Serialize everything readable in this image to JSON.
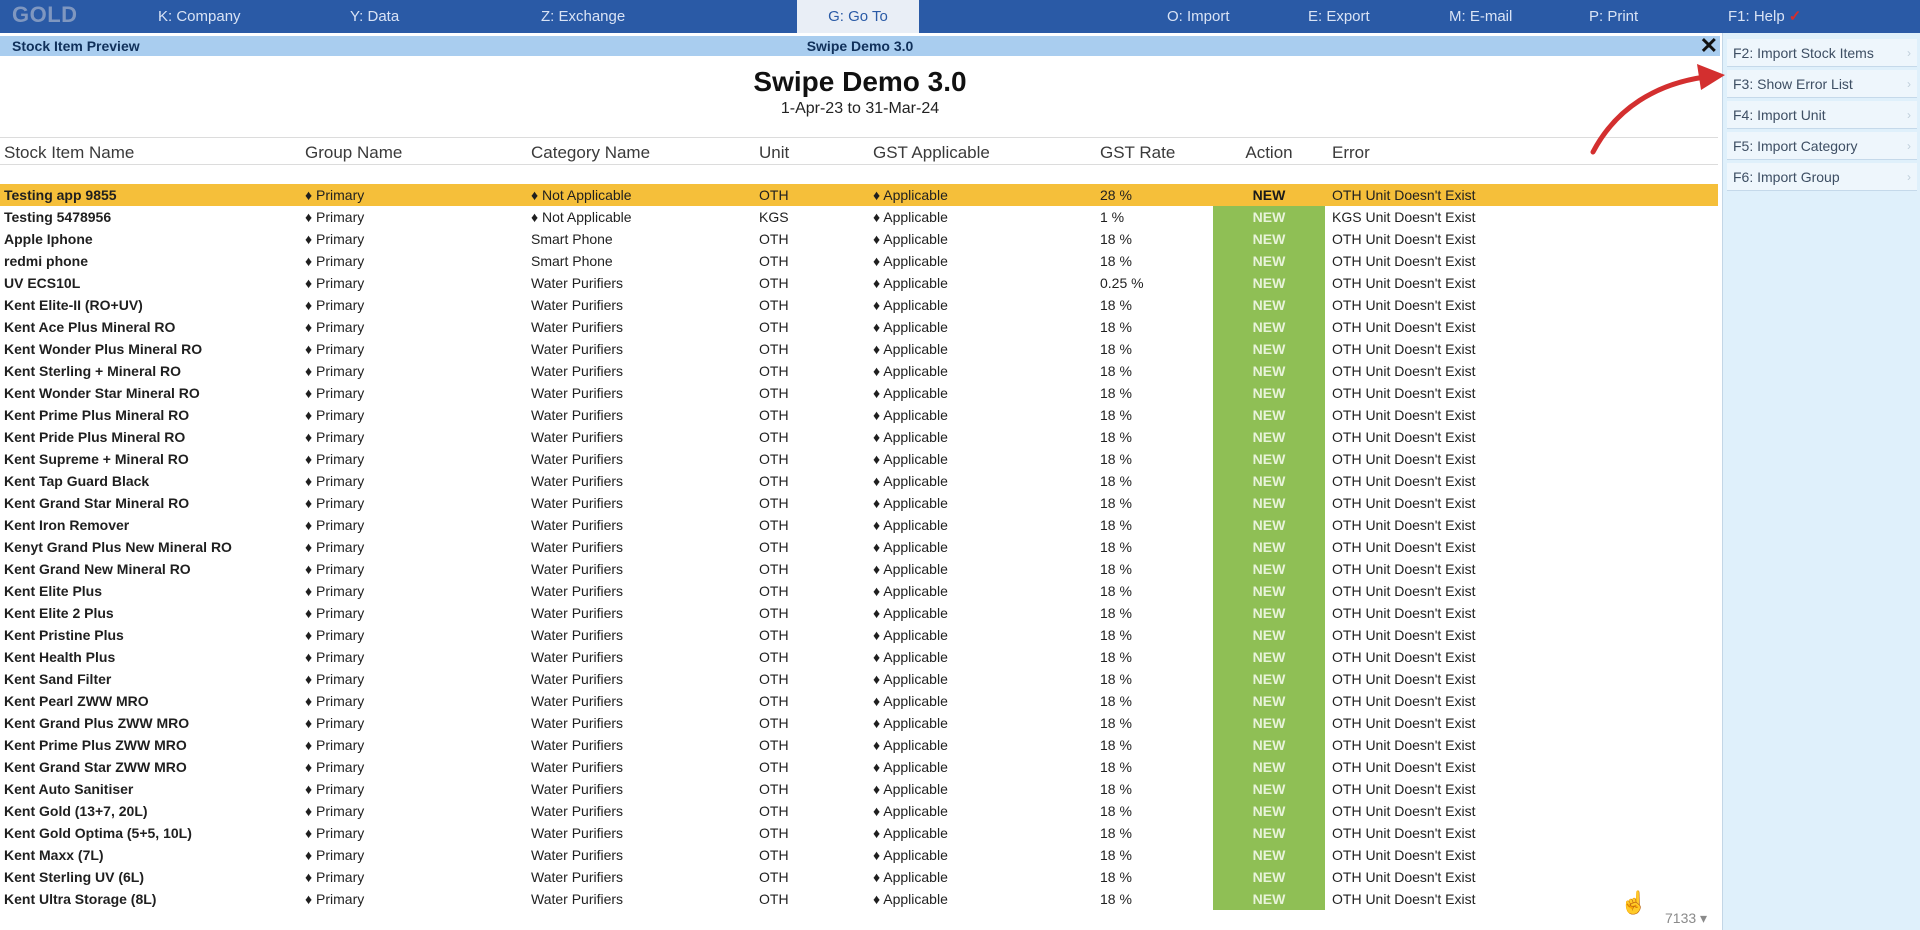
{
  "topbar": {
    "logo": "GOLD",
    "menu": [
      {
        "label": "K: Company"
      },
      {
        "label": "Y: Data"
      },
      {
        "label": "Z: Exchange"
      },
      {
        "label": "G: Go To"
      },
      {
        "label": "O: Import"
      },
      {
        "label": "E: Export"
      },
      {
        "label": "M: E-mail"
      },
      {
        "label": "P: Print"
      },
      {
        "label": "F1: Help"
      }
    ]
  },
  "titlebar": {
    "left": "Stock Item Preview",
    "center": "Swipe Demo 3.0",
    "close": "✕"
  },
  "report": {
    "title": "Swipe Demo 3.0",
    "period": "1-Apr-23 to 31-Mar-24"
  },
  "columns": {
    "name": "Stock Item Name",
    "group": "Group Name",
    "category": "Category Name",
    "unit": "Unit",
    "gst": "GST Applicable",
    "rate": "GST Rate",
    "action": "Action",
    "error": "Error"
  },
  "rows": [
    {
      "name": "Testing app 9855",
      "group": "♦ Primary",
      "category": "♦ Not Applicable",
      "unit": "OTH",
      "gst": "♦ Applicable",
      "rate": "28 %",
      "action": "NEW",
      "error": "OTH Unit Doesn't Exist"
    },
    {
      "name": "Testing 5478956",
      "group": "♦ Primary",
      "category": "♦ Not Applicable",
      "unit": "KGS",
      "gst": "♦ Applicable",
      "rate": "1 %",
      "action": "NEW",
      "error": "KGS Unit Doesn't Exist"
    },
    {
      "name": "Apple Iphone",
      "group": "♦ Primary",
      "category": "Smart Phone",
      "unit": "OTH",
      "gst": "♦ Applicable",
      "rate": "18 %",
      "action": "NEW",
      "error": "OTH Unit Doesn't Exist"
    },
    {
      "name": "redmi phone",
      "group": "♦ Primary",
      "category": "Smart Phone",
      "unit": "OTH",
      "gst": "♦ Applicable",
      "rate": "18 %",
      "action": "NEW",
      "error": "OTH Unit Doesn't Exist"
    },
    {
      "name": "UV ECS10L",
      "group": "♦ Primary",
      "category": "Water Purifiers",
      "unit": "OTH",
      "gst": "♦ Applicable",
      "rate": "0.25 %",
      "action": "NEW",
      "error": "OTH Unit Doesn't Exist"
    },
    {
      "name": "Kent Elite-II (RO+UV)",
      "group": "♦ Primary",
      "category": "Water Purifiers",
      "unit": "OTH",
      "gst": "♦ Applicable",
      "rate": "18 %",
      "action": "NEW",
      "error": "OTH Unit Doesn't Exist"
    },
    {
      "name": "Kent Ace Plus Mineral RO",
      "group": "♦ Primary",
      "category": "Water Purifiers",
      "unit": "OTH",
      "gst": "♦ Applicable",
      "rate": "18 %",
      "action": "NEW",
      "error": "OTH Unit Doesn't Exist"
    },
    {
      "name": "Kent Wonder Plus Mineral RO",
      "group": "♦ Primary",
      "category": "Water Purifiers",
      "unit": "OTH",
      "gst": "♦ Applicable",
      "rate": "18 %",
      "action": "NEW",
      "error": "OTH Unit Doesn't Exist"
    },
    {
      "name": "Kent Sterling + Mineral RO",
      "group": "♦ Primary",
      "category": "Water Purifiers",
      "unit": "OTH",
      "gst": "♦ Applicable",
      "rate": "18 %",
      "action": "NEW",
      "error": "OTH Unit Doesn't Exist"
    },
    {
      "name": "Kent Wonder Star Mineral RO",
      "group": "♦ Primary",
      "category": "Water Purifiers",
      "unit": "OTH",
      "gst": "♦ Applicable",
      "rate": "18 %",
      "action": "NEW",
      "error": "OTH Unit Doesn't Exist"
    },
    {
      "name": "Kent Prime Plus Mineral RO",
      "group": "♦ Primary",
      "category": "Water Purifiers",
      "unit": "OTH",
      "gst": "♦ Applicable",
      "rate": "18 %",
      "action": "NEW",
      "error": "OTH Unit Doesn't Exist"
    },
    {
      "name": "Kent Pride Plus Mineral RO",
      "group": "♦ Primary",
      "category": "Water Purifiers",
      "unit": "OTH",
      "gst": "♦ Applicable",
      "rate": "18 %",
      "action": "NEW",
      "error": "OTH Unit Doesn't Exist"
    },
    {
      "name": "Kent Supreme + Mineral RO",
      "group": "♦ Primary",
      "category": "Water Purifiers",
      "unit": "OTH",
      "gst": "♦ Applicable",
      "rate": "18 %",
      "action": "NEW",
      "error": "OTH Unit Doesn't Exist"
    },
    {
      "name": "Kent Tap Guard Black",
      "group": "♦ Primary",
      "category": "Water Purifiers",
      "unit": "OTH",
      "gst": "♦ Applicable",
      "rate": "18 %",
      "action": "NEW",
      "error": "OTH Unit Doesn't Exist"
    },
    {
      "name": "Kent Grand Star Mineral RO",
      "group": "♦ Primary",
      "category": "Water Purifiers",
      "unit": "OTH",
      "gst": "♦ Applicable",
      "rate": "18 %",
      "action": "NEW",
      "error": "OTH Unit Doesn't Exist"
    },
    {
      "name": "Kent Iron Remover",
      "group": "♦ Primary",
      "category": "Water Purifiers",
      "unit": "OTH",
      "gst": "♦ Applicable",
      "rate": "18 %",
      "action": "NEW",
      "error": "OTH Unit Doesn't Exist"
    },
    {
      "name": "Kenyt Grand Plus New Mineral RO",
      "group": "♦ Primary",
      "category": "Water Purifiers",
      "unit": "OTH",
      "gst": "♦ Applicable",
      "rate": "18 %",
      "action": "NEW",
      "error": "OTH Unit Doesn't Exist"
    },
    {
      "name": "Kent Grand New Mineral RO",
      "group": "♦ Primary",
      "category": "Water Purifiers",
      "unit": "OTH",
      "gst": "♦ Applicable",
      "rate": "18 %",
      "action": "NEW",
      "error": "OTH Unit Doesn't Exist"
    },
    {
      "name": "Kent Elite Plus",
      "group": "♦ Primary",
      "category": "Water Purifiers",
      "unit": "OTH",
      "gst": "♦ Applicable",
      "rate": "18 %",
      "action": "NEW",
      "error": "OTH Unit Doesn't Exist"
    },
    {
      "name": "Kent Elite 2 Plus",
      "group": "♦ Primary",
      "category": "Water Purifiers",
      "unit": "OTH",
      "gst": "♦ Applicable",
      "rate": "18 %",
      "action": "NEW",
      "error": "OTH Unit Doesn't Exist"
    },
    {
      "name": "Kent Pristine Plus",
      "group": "♦ Primary",
      "category": "Water Purifiers",
      "unit": "OTH",
      "gst": "♦ Applicable",
      "rate": "18 %",
      "action": "NEW",
      "error": "OTH Unit Doesn't Exist"
    },
    {
      "name": "Kent Health Plus",
      "group": "♦ Primary",
      "category": "Water Purifiers",
      "unit": "OTH",
      "gst": "♦ Applicable",
      "rate": "18 %",
      "action": "NEW",
      "error": "OTH Unit Doesn't Exist"
    },
    {
      "name": "Kent Sand Filter",
      "group": "♦ Primary",
      "category": "Water Purifiers",
      "unit": "OTH",
      "gst": "♦ Applicable",
      "rate": "18 %",
      "action": "NEW",
      "error": "OTH Unit Doesn't Exist"
    },
    {
      "name": "Kent Pearl ZWW MRO",
      "group": "♦ Primary",
      "category": "Water Purifiers",
      "unit": "OTH",
      "gst": "♦ Applicable",
      "rate": "18 %",
      "action": "NEW",
      "error": "OTH Unit Doesn't Exist"
    },
    {
      "name": "Kent Grand Plus ZWW MRO",
      "group": "♦ Primary",
      "category": "Water Purifiers",
      "unit": "OTH",
      "gst": "♦ Applicable",
      "rate": "18 %",
      "action": "NEW",
      "error": "OTH Unit Doesn't Exist"
    },
    {
      "name": "Kent Prime Plus ZWW MRO",
      "group": "♦ Primary",
      "category": "Water Purifiers",
      "unit": "OTH",
      "gst": "♦ Applicable",
      "rate": "18 %",
      "action": "NEW",
      "error": "OTH Unit Doesn't Exist"
    },
    {
      "name": "Kent Grand Star ZWW MRO",
      "group": "♦ Primary",
      "category": "Water Purifiers",
      "unit": "OTH",
      "gst": "♦ Applicable",
      "rate": "18 %",
      "action": "NEW",
      "error": "OTH Unit Doesn't Exist"
    },
    {
      "name": "Kent Auto Sanitiser",
      "group": "♦ Primary",
      "category": "Water Purifiers",
      "unit": "OTH",
      "gst": "♦ Applicable",
      "rate": "18 %",
      "action": "NEW",
      "error": "OTH Unit Doesn't Exist"
    },
    {
      "name": "Kent Gold (13+7, 20L)",
      "group": "♦ Primary",
      "category": "Water Purifiers",
      "unit": "OTH",
      "gst": "♦ Applicable",
      "rate": "18 %",
      "action": "NEW",
      "error": "OTH Unit Doesn't Exist"
    },
    {
      "name": "Kent Gold Optima (5+5, 10L)",
      "group": "♦ Primary",
      "category": "Water Purifiers",
      "unit": "OTH",
      "gst": "♦ Applicable",
      "rate": "18 %",
      "action": "NEW",
      "error": "OTH Unit Doesn't Exist"
    },
    {
      "name": "Kent Maxx (7L)",
      "group": "♦ Primary",
      "category": "Water Purifiers",
      "unit": "OTH",
      "gst": "♦ Applicable",
      "rate": "18 %",
      "action": "NEW",
      "error": "OTH Unit Doesn't Exist"
    },
    {
      "name": "Kent Sterling UV (6L)",
      "group": "♦ Primary",
      "category": "Water Purifiers",
      "unit": "OTH",
      "gst": "♦ Applicable",
      "rate": "18 %",
      "action": "NEW",
      "error": "OTH Unit Doesn't Exist"
    },
    {
      "name": "Kent Ultra Storage (8L)",
      "group": "♦ Primary",
      "category": "Water Purifiers",
      "unit": "OTH",
      "gst": "♦ Applicable",
      "rate": "18 %",
      "action": "NEW",
      "error": "OTH Unit Doesn't Exist"
    }
  ],
  "footer": {
    "count": "7133 ▾"
  },
  "sidepanel": [
    {
      "key": "F2:",
      "label": "Import Stock Items"
    },
    {
      "key": "F3:",
      "label": "Show Error List"
    },
    {
      "key": "F4:",
      "label": "Import Unit"
    },
    {
      "key": "F5:",
      "label": "Import Category"
    },
    {
      "key": "F6:",
      "label": "Import Group"
    }
  ],
  "colors": {
    "topbar": "#2a5aa6",
    "titlebar": "#a9cdef",
    "selected_row": "#f5bf3a",
    "action_cell": "#8fbf55",
    "sidepanel": "#dff0fb",
    "annotation_arrow": "#d32f2f"
  },
  "icons": {
    "close": "close-icon",
    "cursor": "hand-cursor-icon",
    "annotation": "red-arrow-icon"
  }
}
